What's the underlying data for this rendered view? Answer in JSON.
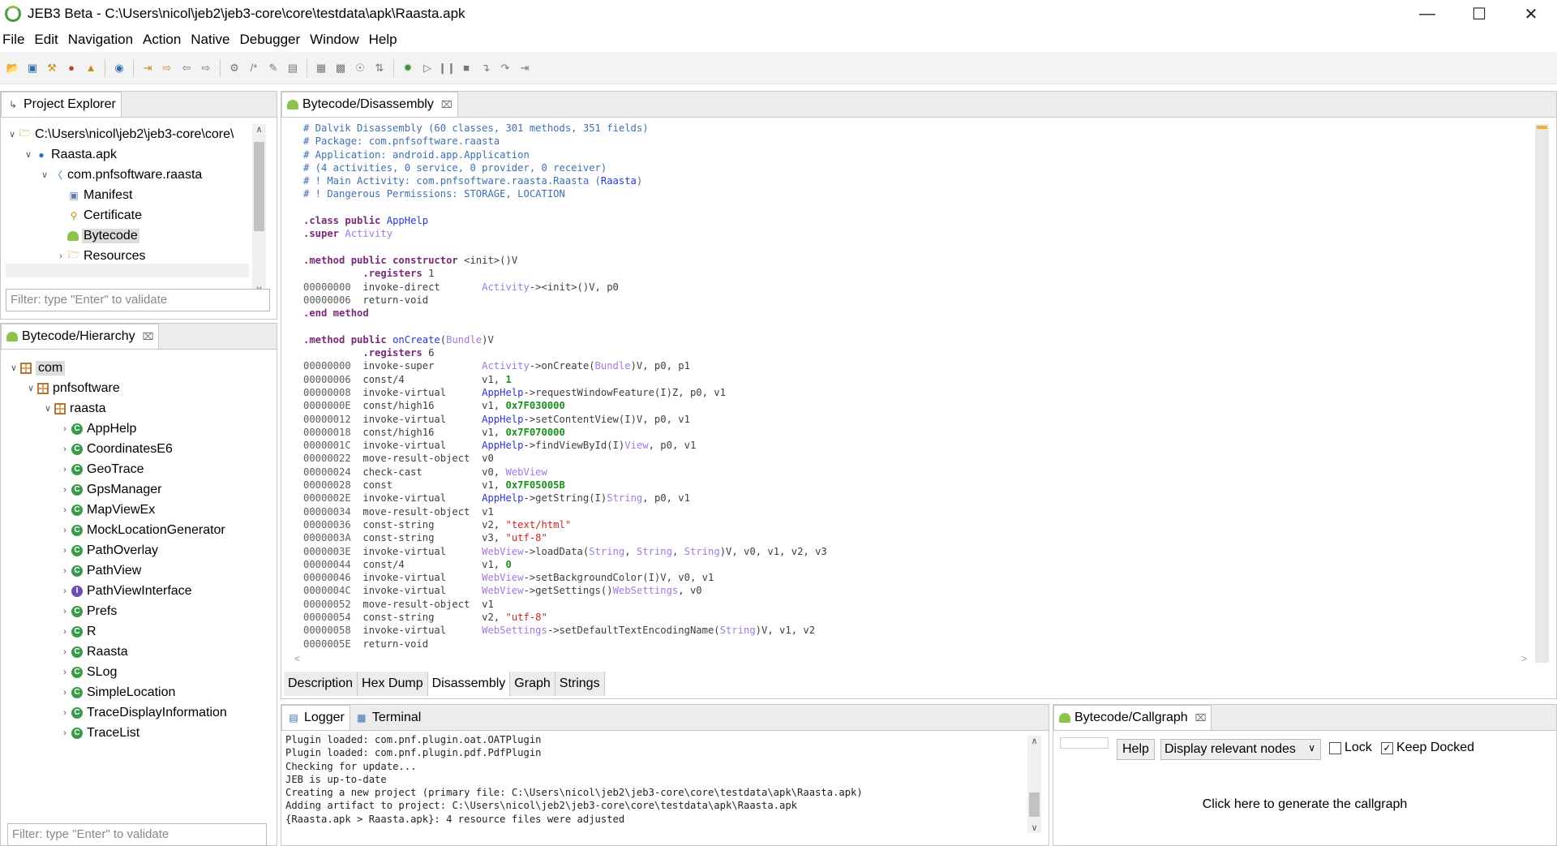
{
  "window": {
    "title": "JEB3 Beta - C:\\Users\\nicol\\jeb2\\jeb3-core\\core\\testdata\\apk\\Raasta.apk",
    "controls": [
      "—",
      "☐",
      "✕"
    ]
  },
  "menu": [
    "File",
    "Edit",
    "Navigation",
    "Action",
    "Native",
    "Debugger",
    "Window",
    "Help"
  ],
  "project_explorer": {
    "tab": "Project Explorer",
    "tree": [
      {
        "label": "C:\\Users\\nicol\\jeb2\\jeb3-core\\core\\",
        "depth": 0,
        "arrow": "v",
        "icon": "folder-icon"
      },
      {
        "label": "Raasta.apk",
        "depth": 1,
        "arrow": "v",
        "icon": "apk-icon"
      },
      {
        "label": "com.pnfsoftware.raasta",
        "depth": 2,
        "arrow": "v",
        "icon": "unit-icon"
      },
      {
        "label": "Manifest",
        "depth": 3,
        "arrow": "",
        "icon": "manifest-icon"
      },
      {
        "label": "Certificate",
        "depth": 3,
        "arrow": "",
        "icon": "certificate-icon"
      },
      {
        "label": "Bytecode",
        "depth": 3,
        "arrow": "",
        "icon": "android-icon",
        "selected": true
      },
      {
        "label": "Resources",
        "depth": 3,
        "arrow": ">",
        "icon": "folder-icon"
      }
    ],
    "filter_placeholder": "Filter: type \"Enter\" to validate"
  },
  "hierarchy": {
    "tab": "Bytecode/Hierarchy",
    "tree": [
      {
        "label": "com",
        "depth": 0,
        "arrow": "v",
        "kind": "package",
        "selected": true
      },
      {
        "label": "pnfsoftware",
        "depth": 1,
        "arrow": "v",
        "kind": "package"
      },
      {
        "label": "raasta",
        "depth": 2,
        "arrow": "v",
        "kind": "package"
      },
      {
        "label": "AppHelp",
        "depth": 3,
        "arrow": ">",
        "kind": "class"
      },
      {
        "label": "CoordinatesE6",
        "depth": 3,
        "arrow": ">",
        "kind": "class"
      },
      {
        "label": "GeoTrace",
        "depth": 3,
        "arrow": ">",
        "kind": "class"
      },
      {
        "label": "GpsManager",
        "depth": 3,
        "arrow": ">",
        "kind": "class"
      },
      {
        "label": "MapViewEx",
        "depth": 3,
        "arrow": ">",
        "kind": "class"
      },
      {
        "label": "MockLocationGenerator",
        "depth": 3,
        "arrow": ">",
        "kind": "class"
      },
      {
        "label": "PathOverlay",
        "depth": 3,
        "arrow": ">",
        "kind": "class"
      },
      {
        "label": "PathView",
        "depth": 3,
        "arrow": ">",
        "kind": "class"
      },
      {
        "label": "PathViewInterface",
        "depth": 3,
        "arrow": ">",
        "kind": "interface"
      },
      {
        "label": "Prefs",
        "depth": 3,
        "arrow": ">",
        "kind": "class"
      },
      {
        "label": "R",
        "depth": 3,
        "arrow": ">",
        "kind": "class"
      },
      {
        "label": "Raasta",
        "depth": 3,
        "arrow": ">",
        "kind": "class"
      },
      {
        "label": "SLog",
        "depth": 3,
        "arrow": ">",
        "kind": "class"
      },
      {
        "label": "SimpleLocation",
        "depth": 3,
        "arrow": ">",
        "kind": "class"
      },
      {
        "label": "TraceDisplayInformation",
        "depth": 3,
        "arrow": ">",
        "kind": "class"
      },
      {
        "label": "TraceList",
        "depth": 3,
        "arrow": ">",
        "kind": "class"
      }
    ],
    "filter_placeholder": "Filter: type \"Enter\" to validate"
  },
  "editor": {
    "tab": "Bytecode/Disassembly",
    "bottom_tabs": [
      "Description",
      "Hex Dump",
      "Disassembly",
      "Graph",
      "Strings"
    ],
    "active_bottom_tab": "Disassembly",
    "lines": [
      [
        [
          "cm",
          "# Dalvik Disassembly (60 classes, 301 methods, 351 fields)"
        ]
      ],
      [
        [
          "cm",
          "# Package: com.pnfsoftware.raasta"
        ]
      ],
      [
        [
          "cm",
          "# Application: android.app.Application"
        ]
      ],
      [
        [
          "cm",
          "# (4 activities, 0 service, 0 provider, 0 receiver)"
        ]
      ],
      [
        [
          "cm",
          "# ! Main Activity: com.pnfsoftware.raasta.Raasta ("
        ],
        [
          "mt",
          "Raasta"
        ],
        [
          "cm",
          ")"
        ]
      ],
      [
        [
          "cm",
          "# ! Dangerous Permissions: STORAGE, LOCATION"
        ]
      ],
      [],
      [
        [
          "kw",
          ".class public "
        ],
        [
          "mt",
          "AppHelp"
        ]
      ],
      [
        [
          "kw",
          ".super "
        ],
        [
          "ty",
          "Activity"
        ]
      ],
      [],
      [
        [
          "kw",
          ".method public constructor "
        ],
        [
          "",
          "<init>()V"
        ]
      ],
      [
        [
          "",
          "          "
        ],
        [
          "kw",
          ".registers "
        ],
        [
          "",
          "1"
        ]
      ],
      [
        [
          "ad",
          "00000000  "
        ],
        [
          "",
          "invoke-direct       "
        ],
        [
          "ty",
          "Activity"
        ],
        [
          "",
          "-><init>()V, p0"
        ]
      ],
      [
        [
          "ad",
          "00000006  "
        ],
        [
          "",
          "return-void"
        ]
      ],
      [
        [
          "kw",
          ".end method"
        ]
      ],
      [],
      [
        [
          "kw",
          ".method public "
        ],
        [
          "mt",
          "onCreate"
        ],
        [
          "",
          "("
        ],
        [
          "ty",
          "Bundle"
        ],
        [
          "",
          ")V"
        ]
      ],
      [
        [
          "",
          "          "
        ],
        [
          "kw",
          ".registers "
        ],
        [
          "",
          "6"
        ]
      ],
      [
        [
          "ad",
          "00000000  "
        ],
        [
          "",
          "invoke-super        "
        ],
        [
          "ty",
          "Activity"
        ],
        [
          "",
          "->onCreate("
        ],
        [
          "ty",
          "Bundle"
        ],
        [
          "",
          ")V, p0, p1"
        ]
      ],
      [
        [
          "ad",
          "00000006  "
        ],
        [
          "",
          "const/4             v1, "
        ],
        [
          "nm",
          "1"
        ]
      ],
      [
        [
          "ad",
          "00000008  "
        ],
        [
          "",
          "invoke-virtual      "
        ],
        [
          "mt",
          "AppHelp"
        ],
        [
          "",
          "->requestWindowFeature(I)Z, p0, v1"
        ]
      ],
      [
        [
          "ad",
          "0000000E  "
        ],
        [
          "",
          "const/high16        v1, "
        ],
        [
          "nm",
          "0x7F030000"
        ]
      ],
      [
        [
          "ad",
          "00000012  "
        ],
        [
          "",
          "invoke-virtual      "
        ],
        [
          "mt",
          "AppHelp"
        ],
        [
          "",
          "->setContentView(I)V, p0, v1"
        ]
      ],
      [
        [
          "ad",
          "00000018  "
        ],
        [
          "",
          "const/high16        v1, "
        ],
        [
          "nm",
          "0x7F070000"
        ]
      ],
      [
        [
          "ad",
          "0000001C  "
        ],
        [
          "",
          "invoke-virtual      "
        ],
        [
          "mt",
          "AppHelp"
        ],
        [
          "",
          "->findViewById(I)"
        ],
        [
          "ty",
          "View"
        ],
        [
          "",
          ", p0, v1"
        ]
      ],
      [
        [
          "ad",
          "00000022  "
        ],
        [
          "",
          "move-result-object  v0"
        ]
      ],
      [
        [
          "ad",
          "00000024  "
        ],
        [
          "",
          "check-cast          v0, "
        ],
        [
          "ty",
          "WebView"
        ]
      ],
      [
        [
          "ad",
          "00000028  "
        ],
        [
          "",
          "const               v1, "
        ],
        [
          "nm",
          "0x7F05005B"
        ]
      ],
      [
        [
          "ad",
          "0000002E  "
        ],
        [
          "",
          "invoke-virtual      "
        ],
        [
          "mt",
          "AppHelp"
        ],
        [
          "",
          "->getString(I)"
        ],
        [
          "ty",
          "String"
        ],
        [
          "",
          ", p0, v1"
        ]
      ],
      [
        [
          "ad",
          "00000034  "
        ],
        [
          "",
          "move-result-object  v1"
        ]
      ],
      [
        [
          "ad",
          "00000036  "
        ],
        [
          "",
          "const-string        v2, "
        ],
        [
          "st",
          "\"text/html\""
        ]
      ],
      [
        [
          "ad",
          "0000003A  "
        ],
        [
          "",
          "const-string        v3, "
        ],
        [
          "st",
          "\"utf-8\""
        ]
      ],
      [
        [
          "ad",
          "0000003E  "
        ],
        [
          "",
          "invoke-virtual      "
        ],
        [
          "ty",
          "WebView"
        ],
        [
          "",
          "->loadData("
        ],
        [
          "ty",
          "String"
        ],
        [
          "",
          ", "
        ],
        [
          "ty",
          "String"
        ],
        [
          "",
          ", "
        ],
        [
          "ty",
          "String"
        ],
        [
          "",
          ")V, v0, v1, v2, v3"
        ]
      ],
      [
        [
          "ad",
          "00000044  "
        ],
        [
          "",
          "const/4             v1, "
        ],
        [
          "nm",
          "0"
        ]
      ],
      [
        [
          "ad",
          "00000046  "
        ],
        [
          "",
          "invoke-virtual      "
        ],
        [
          "ty",
          "WebView"
        ],
        [
          "",
          "->setBackgroundColor(I)V, v0, v1"
        ]
      ],
      [
        [
          "ad",
          "0000004C  "
        ],
        [
          "",
          "invoke-virtual      "
        ],
        [
          "ty",
          "WebView"
        ],
        [
          "",
          "->getSettings()"
        ],
        [
          "ty",
          "WebSettings"
        ],
        [
          "",
          ", v0"
        ]
      ],
      [
        [
          "ad",
          "00000052  "
        ],
        [
          "",
          "move-result-object  v1"
        ]
      ],
      [
        [
          "ad",
          "00000054  "
        ],
        [
          "",
          "const-string        v2, "
        ],
        [
          "st",
          "\"utf-8\""
        ]
      ],
      [
        [
          "ad",
          "00000058  "
        ],
        [
          "",
          "invoke-virtual      "
        ],
        [
          "ty",
          "WebSettings"
        ],
        [
          "",
          "->setDefaultTextEncodingName("
        ],
        [
          "ty",
          "String"
        ],
        [
          "",
          ")V, v1, v2"
        ]
      ],
      [
        [
          "ad",
          "0000005E  "
        ],
        [
          "",
          "return-void"
        ]
      ]
    ]
  },
  "logger": {
    "tabs": [
      "Logger",
      "Terminal"
    ],
    "lines": [
      "Plugin loaded: com.pnf.plugin.oat.OATPlugin",
      "Plugin loaded: com.pnf.plugin.pdf.PdfPlugin",
      "Checking for update...",
      "JEB is up-to-date",
      "Creating a new project (primary file: C:\\Users\\nicol\\jeb2\\jeb3-core\\core\\testdata\\apk\\Raasta.apk)",
      "Adding artifact to project: C:\\Users\\nicol\\jeb2\\jeb3-core\\core\\testdata\\apk\\Raasta.apk",
      "{Raasta.apk > Raasta.apk}: 4 resource files were adjusted"
    ]
  },
  "callgraph": {
    "tab": "Bytecode/Callgraph",
    "help_label": "Help",
    "mode_select": "Display relevant nodes",
    "lock_label": "Lock",
    "lock_checked": false,
    "keep_docked_label": "Keep Docked",
    "keep_docked_checked": true,
    "message": "Click here to generate the callgraph"
  }
}
